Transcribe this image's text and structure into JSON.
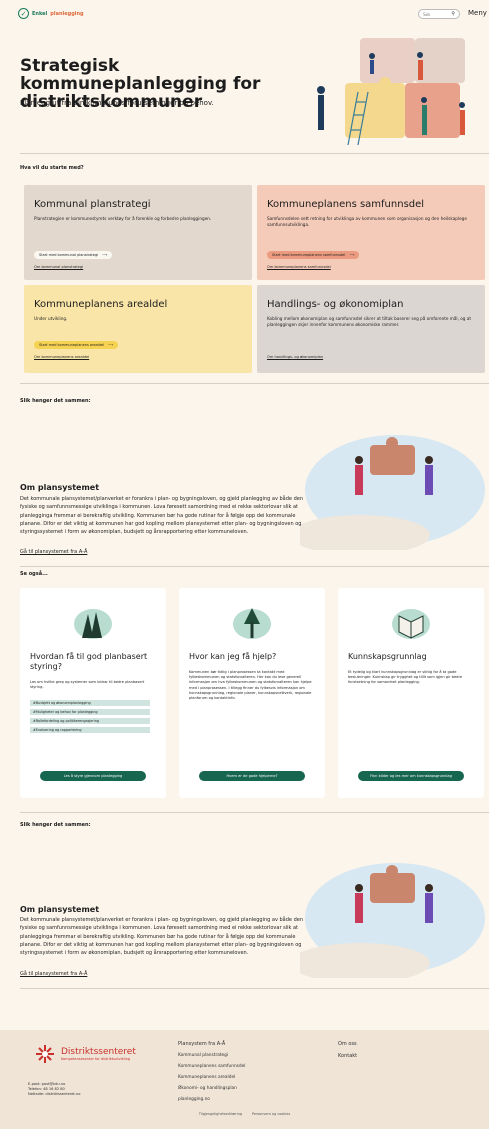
{
  "header": {
    "logo_enkel": "Enkel",
    "logo_plan": "planlegging",
    "search_placeholder": "Søk",
    "menu_label": "Meny"
  },
  "hero": {
    "title": "Strategisk kommuneplanlegging for distriktskommuner",
    "subtitle": "Planlegg ut fra din kommunes forutsetninger og behov."
  },
  "start": {
    "label": "Hva vil du starte med?",
    "cards": [
      {
        "title": "Kommunal planstrategi",
        "text": "Planstrategien er kommunestyrets verktøy for å forenkle og forbedre planleggingen.",
        "button": "Start med kommunal planstrategi",
        "link": "Om kommunal planstrategi",
        "color": "#e3d8cd"
      },
      {
        "title": "Kommuneplanens samfunnsdel",
        "text": "Samfunnsdelen sett retning for utviklinga av kommunen som organisasjon og den heilskaplege samfunnsutviklinga.",
        "button": "Start med kommuneplanens samfunnsdel",
        "link": "Om kommuneplanens samfunnsdel",
        "color": "#f4cbb9"
      },
      {
        "title": "Kommuneplanens arealdel",
        "text": "Under utvikling.",
        "button": "Start med kommuneplanens arealdel",
        "link": "Om kommuneplanens arealdel",
        "color": "#f9e5a8"
      },
      {
        "title": "Handlings- og økonomiplan",
        "text": "Kobling mellom økonomiplan og samfunnsdel sikrer at tiltak baserer seg på omforente mål, og at planleggingen skjer innenfor kommunens økonomiske rammer.",
        "link": "Om handlings- og økonomiplan",
        "color": "#dcd6d3"
      }
    ]
  },
  "om": {
    "label": "Slik henger det sammen:",
    "title": "Om plansystemet",
    "text": "Det kommunale plansystemet/planverket er forankra i plan- og bygningsloven, og gjeld planlegging av både den fysiske og samfunnsmessige utviklinga i kommunen. Lova føresett samordning med ei rekke sektorlovar slik at planlegginga fremmar ei berekraftig utvikling. Kommunen bør ha gode rutinar for å følgje opp dei kommunale planane. Difor er det viktig at kommunen har god kopling mellom plansystemet etter plan- og bygningsloven og styringssystemet i form av økonomiplan, budsjett og årsrapportering etter kommuneloven.",
    "link": "Gå til plansystemet fra A-Å"
  },
  "see_also": {
    "label": "Se også...",
    "cards": [
      {
        "title": "Hvordan få til god planbasert styring?",
        "text": "Les om hvilke grep og systemer som bidrar til bedre planbasert styring.",
        "tags": [
          "#Budsjett og økonomiplanlegging",
          "#Muligheter og behov for planlegging",
          "#Rollefordeling og politikerengasjering",
          "#Evaluering og rapportering"
        ],
        "button": "Les å styre gjennom planlegging"
      },
      {
        "title": "Hvor kan jeg få hjelp?",
        "text": "Kommunen bør tidlig i planprosessen ta kontakt med fylkeskommunen og statsforvalteren. Her kan du lese generell informasjon om hva fylkeskommunen og statsforvalteren kan hjelpe med i planprosessen. I tillegg finner du fylkesvis informasjon om kunnskapsgrunnlag, regionale planer, kunnskapsnettverk, regionale planforum og kontaktinfo.",
        "button": "Hvem er de gode hjelperne?"
      },
      {
        "title": "Kunnskapsgrunnlag",
        "text": "Et tydelig og klart kunnskapsgrunnlag er viktig for å ta gode beslutninger. Kunnskap gir trygghet og tillit som igjen gir bedre forutsetning for samordnet planlegging.",
        "button": "Finn kilder og les mer om kunnskapsgrunnlag"
      }
    ]
  },
  "footer": {
    "org_name": "Distriktssenteret",
    "org_tagline": "Kompetansesenter for distriktsutvikling",
    "contact": [
      "E-post: post@kdu.no",
      "Telefon: 48 16 82 80",
      "Nettside: distriktssenteret.no"
    ],
    "links_col1": [
      "Plansystem fra A-Å",
      "Kommunal planstrategi",
      "Kommuneplanens samfunnsdel",
      "Kommuneplanens arealdel",
      "Økonomi- og handlingsplan",
      "planlegging.no"
    ],
    "links_col2": [
      "Om oss",
      "Kontakt"
    ],
    "bottom_links": [
      "Tilgjengelighetserklæring",
      "Personvern og cookies"
    ]
  }
}
